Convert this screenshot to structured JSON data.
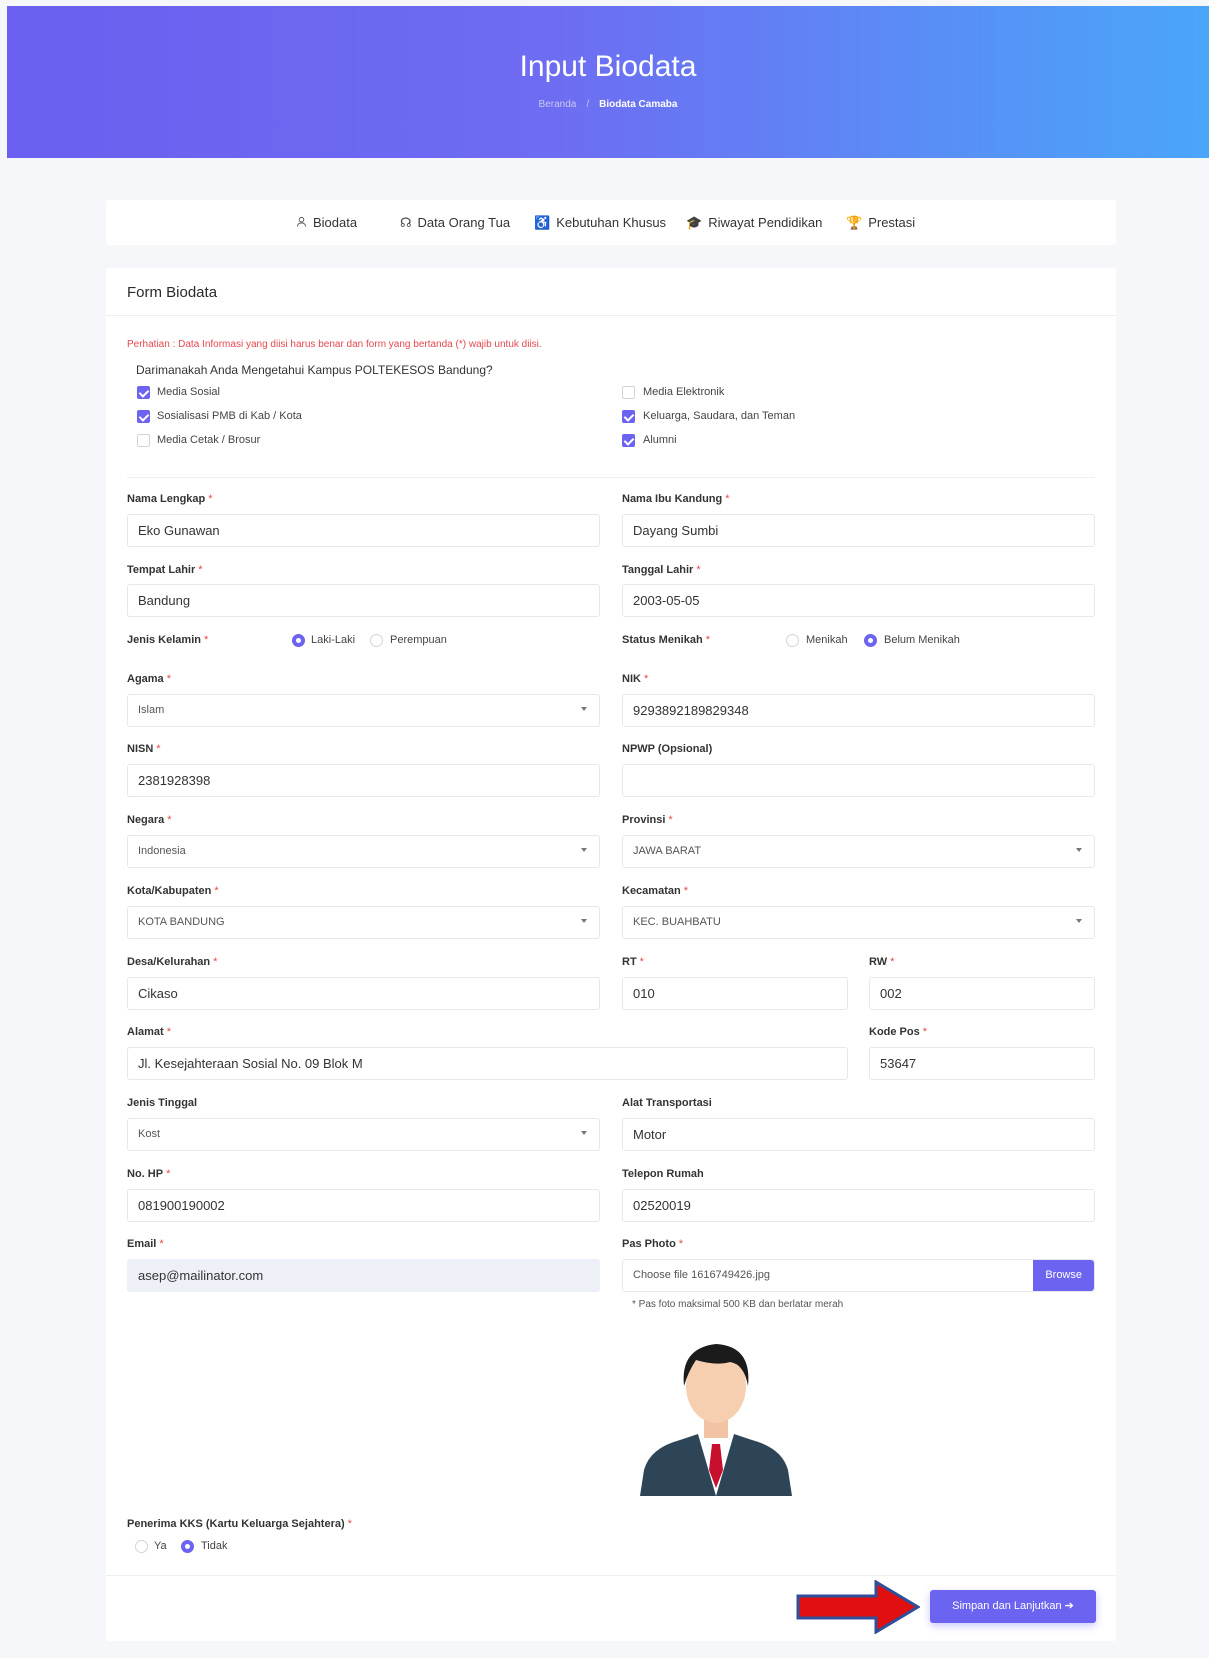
{
  "header": {
    "title": "Input Biodata",
    "breadcrumb": [
      "Beranda",
      "Biodata Camaba"
    ]
  },
  "tabs": [
    {
      "label": "Biodata",
      "icon": "user-icon"
    },
    {
      "label": "Data Orang Tua",
      "icon": "parents-icon"
    },
    {
      "label": "Kebutuhan Khusus",
      "icon": "wheelchair-icon"
    },
    {
      "label": "Riwayat Pendidikan",
      "icon": "graduation-cap-icon"
    },
    {
      "label": "Prestasi",
      "icon": "trophy-icon"
    }
  ],
  "form": {
    "title": "Form Biodata",
    "warning": "Perhatian : Data Informasi yang diisi harus benar dan form yang bertanda (*) wajib untuk diisi.",
    "source_question": "Darimanakah Anda Mengetahui Kampus POLTEKESOS Bandung?",
    "sources": [
      {
        "label": "Media Sosial",
        "checked": true
      },
      {
        "label": "Sosialisasi PMB di Kab / Kota",
        "checked": true
      },
      {
        "label": "Media Cetak / Brosur",
        "checked": false
      },
      {
        "label": "Media Elektronik",
        "checked": false
      },
      {
        "label": "Keluarga, Saudara, dan Teman",
        "checked": true
      },
      {
        "label": "Alumni",
        "checked": true
      }
    ],
    "required_mark": "*",
    "fields": {
      "nama_lengkap": {
        "label": "Nama Lengkap",
        "value": "Eko Gunawan"
      },
      "nama_ibu": {
        "label": "Nama Ibu Kandung",
        "value": "Dayang Sumbi"
      },
      "tempat_lahir": {
        "label": "Tempat Lahir",
        "value": "Bandung"
      },
      "tanggal_lahir": {
        "label": "Tanggal Lahir",
        "value": "2003-05-05"
      },
      "jenis_kelamin": {
        "label": "Jenis Kelamin",
        "options": [
          "Laki-Laki",
          "Perempuan"
        ],
        "selected": "Laki-Laki"
      },
      "status_menikah": {
        "label": "Status Menikah",
        "options": [
          "Menikah",
          "Belum Menikah"
        ],
        "selected": "Belum Menikah"
      },
      "agama": {
        "label": "Agama",
        "value": "Islam"
      },
      "nik": {
        "label": "NIK",
        "value": "9293892189829348"
      },
      "nisn": {
        "label": "NISN",
        "value": "2381928398"
      },
      "npwp": {
        "label": "NPWP (Opsional)",
        "value": ""
      },
      "negara": {
        "label": "Negara",
        "value": "Indonesia"
      },
      "provinsi": {
        "label": "Provinsi",
        "value": "JAWA BARAT"
      },
      "kota": {
        "label": "Kota/Kabupaten",
        "value": "KOTA BANDUNG"
      },
      "kecamatan": {
        "label": "Kecamatan",
        "value": "KEC. BUAHBATU"
      },
      "desa": {
        "label": "Desa/Kelurahan",
        "value": "Cikaso"
      },
      "rt": {
        "label": "RT",
        "value": "010"
      },
      "rw": {
        "label": "RW",
        "value": "002"
      },
      "alamat": {
        "label": "Alamat",
        "value": "Jl. Kesejahteraan Sosial No. 09 Blok M"
      },
      "kode_pos": {
        "label": "Kode Pos",
        "value": "53647"
      },
      "jenis_tinggal": {
        "label": "Jenis Tinggal",
        "value": "Kost"
      },
      "alat_transportasi": {
        "label": "Alat Transportasi",
        "value": "Motor"
      },
      "no_hp": {
        "label": "No. HP",
        "value": "081900190002"
      },
      "telepon_rumah": {
        "label": "Telepon Rumah",
        "value": "02520019"
      },
      "email": {
        "label": "Email",
        "value": "asep@mailinator.com"
      },
      "pas_photo": {
        "label": "Pas Photo",
        "value": "Choose file 1616749426.jpg",
        "browse": "Browse",
        "hint": "* Pas foto maksimal 500 KB dan berlatar merah"
      },
      "kks": {
        "label": "Penerima KKS (Kartu Keluarga Sejahtera)",
        "options": [
          "Ya",
          "Tidak"
        ],
        "selected": "Tidak"
      }
    },
    "submit_label": "Simpan dan Lanjutkan ➔"
  },
  "colors": {
    "accent": "#6c63f0",
    "required": "#e5484d",
    "annotation_arrow": "#e01010"
  }
}
